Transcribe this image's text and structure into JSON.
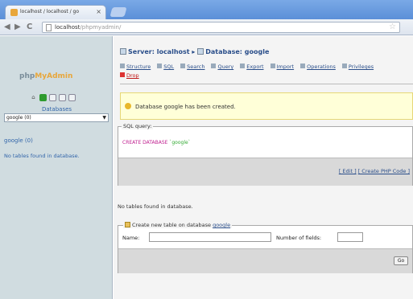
{
  "browser": {
    "tab_title": "localhost / localhost / go",
    "tab_close": "×",
    "url_host": "localhost",
    "url_path": "/phpmyadmin/",
    "back": "◀",
    "forward": "▶",
    "reload": "C",
    "star": "☆"
  },
  "sidebar": {
    "logo_php": "php",
    "logo_my": "MyAdmin",
    "home_glyph": "⌂",
    "databases_label": "Databases",
    "db_select_value": "google (0)",
    "db_select_arrow": "▼",
    "db_name": "google (0)",
    "no_tables": "No tables found in database."
  },
  "main": {
    "server_prefix": "Server: localhost",
    "separator": "▸",
    "database_prefix": "Database: google",
    "tabs": [
      {
        "label": "Structure"
      },
      {
        "label": "SQL"
      },
      {
        "label": "Search"
      },
      {
        "label": "Query"
      },
      {
        "label": "Export"
      },
      {
        "label": "Import"
      },
      {
        "label": "Operations"
      },
      {
        "label": "Privileges"
      },
      {
        "label": "Drop"
      }
    ],
    "notice": "Database google has been created.",
    "sql_legend": "SQL query:",
    "sql_keyword": "CREATE DATABASE",
    "sql_identifier": "`google`",
    "sql_links_edit": "[ Edit ]",
    "sql_links_php": "[ Create PHP Code ]",
    "no_tables": "No tables found in database.",
    "create_legend_prefix": "Create new table on database",
    "create_legend_db": "google",
    "name_label": "Name:",
    "fields_label": "Number of fields:",
    "go_label": "Go"
  }
}
